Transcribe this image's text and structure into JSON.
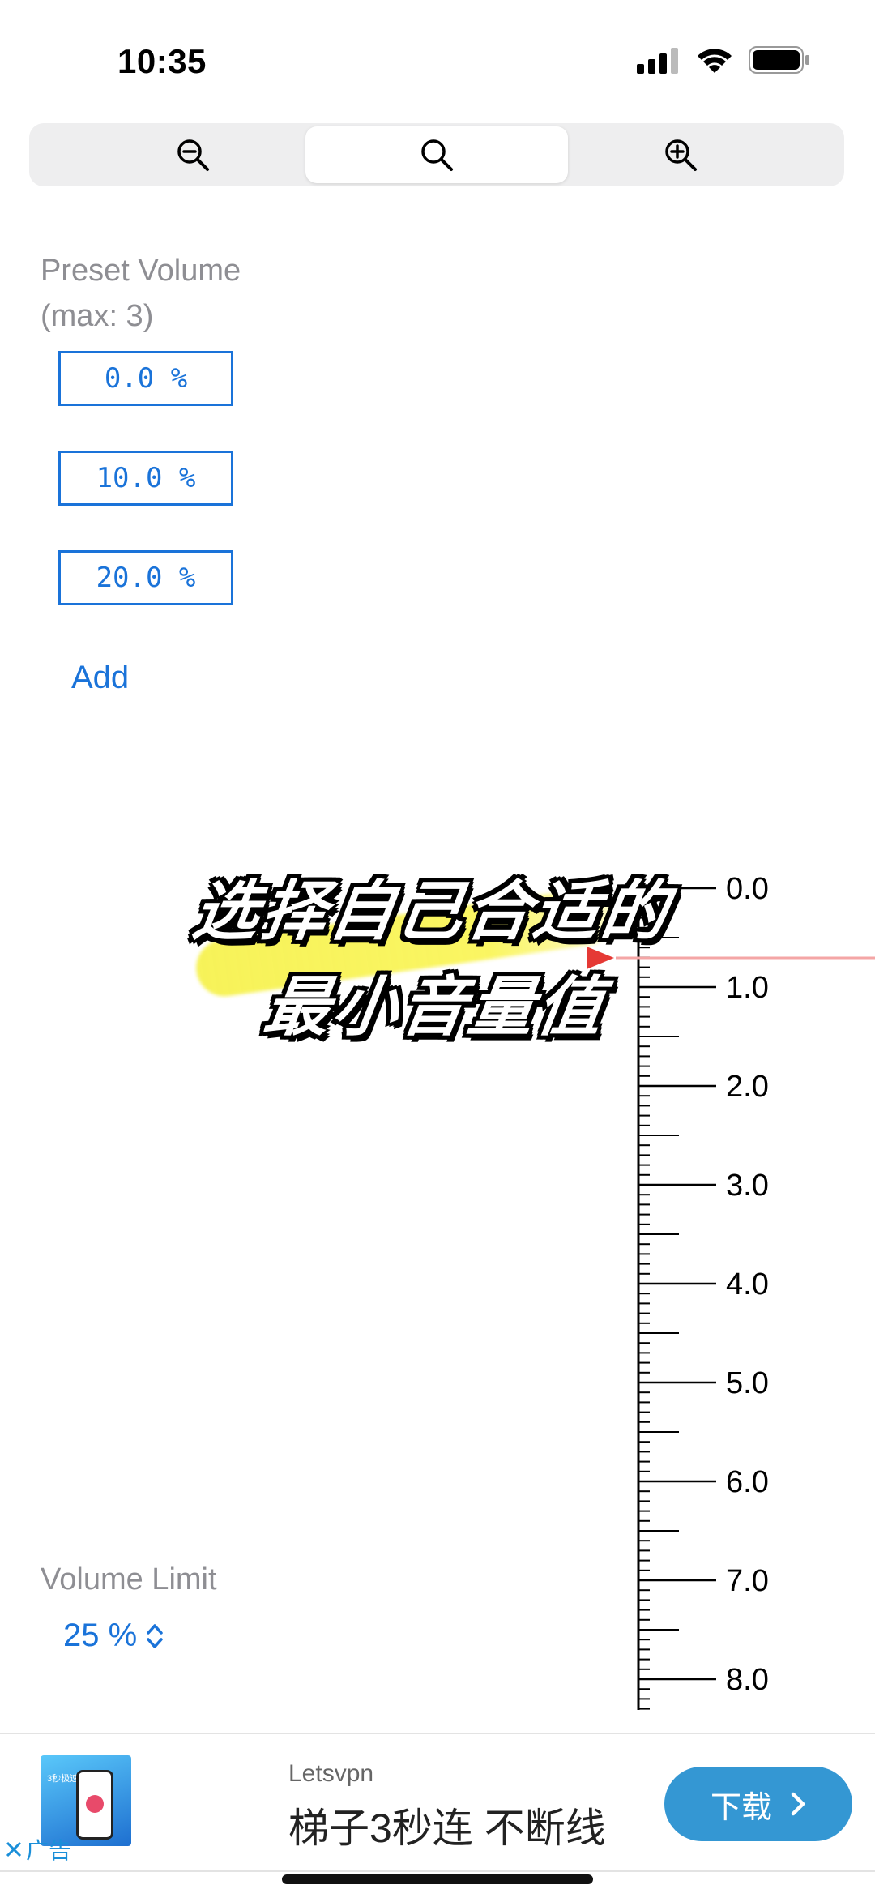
{
  "status_bar": {
    "time": "10:35"
  },
  "zoom": {
    "selected": "zoom-default",
    "icons": [
      "zoom-out-icon",
      "search-icon",
      "zoom-in-icon"
    ]
  },
  "preset": {
    "title_line1": "Preset Volume",
    "title_line2": "(max: 3)",
    "items": [
      "0.0 %",
      "10.0 %",
      "20.0 %"
    ],
    "add_label": "Add"
  },
  "ruler": {
    "labels": [
      "0.0",
      "1.0",
      "2.0",
      "3.0",
      "4.0",
      "5.0",
      "6.0",
      "7.0",
      "8.0"
    ],
    "indicator_color": "#e53935",
    "indicator_value": 0.7
  },
  "overlay": {
    "line1": "选择自己合适的",
    "line2": "最小音量值",
    "highlight_color": "#f5f03c"
  },
  "volume_limit": {
    "title": "Volume Limit",
    "value": "25 %"
  },
  "ad": {
    "thumb_text": "3秒极速连接",
    "close_label": "广告",
    "brand": "Letsvpn",
    "slogan": "梯子3秒连 不断线",
    "download_label": "下载"
  },
  "colors": {
    "accent": "#1a73d9",
    "secondary_text": "#8e8e93",
    "ad_button": "#3497d3"
  }
}
